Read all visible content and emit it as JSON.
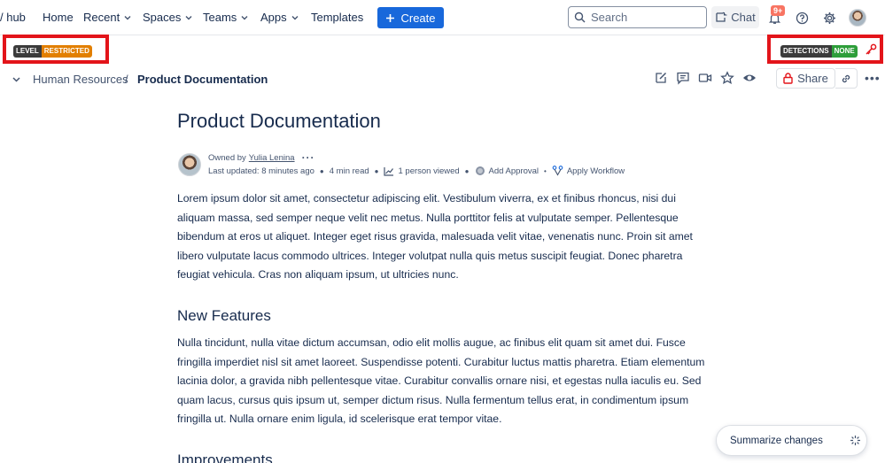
{
  "nav": {
    "brand": "/ hub",
    "home": "Home",
    "recent": "Recent",
    "spaces": "Spaces",
    "teams": "Teams",
    "apps": "Apps",
    "templates": "Templates",
    "create": "Create",
    "search_placeholder": "Search",
    "chat": "Chat",
    "notification_count": "9+"
  },
  "security": {
    "level_label": "LEVEL",
    "level_value": "RESTRICTED",
    "detections_label": "DETECTIONS",
    "detections_value": "NONE"
  },
  "breadcrumb": {
    "parent": "Human Resources",
    "separator": "/",
    "current": "Product Documentation"
  },
  "toolbar": {
    "share": "Share"
  },
  "page": {
    "title": "Product Documentation",
    "owned_by_prefix": "Owned by",
    "owner": "Yulia Lenina",
    "last_updated": "Last updated: 8 minutes ago",
    "read_time": "4 min read",
    "viewed": "1 person viewed",
    "add_approval": "Add Approval",
    "apply_workflow": "Apply Workflow",
    "intro": "Lorem ipsum dolor sit amet, consectetur adipiscing elit. Vestibulum viverra, ex et finibus rhoncus, nisi dui aliquam massa, sed semper neque velit nec metus. Nulla porttitor felis at vulputate semper. Pellentesque bibendum at eros ut aliquet. Integer eget risus gravida, malesuada velit vitae, venenatis nunc. Proin sit amet libero vulputate lacus commodo ultrices. Integer volutpat nulla quis metus suscipit feugiat. Donec pharetra feugiat vehicula. Cras non aliquam ipsum, ut ultricies nunc.",
    "section1_heading": "New Features",
    "section1_body": "Nulla tincidunt, nulla vitae dictum accumsan, odio elit mollis augue, ac finibus elit quam sit amet dui. Fusce fringilla imperdiet nisl sit amet laoreet. Suspendisse potenti. Curabitur luctus mattis pharetra. Etiam elementum lacinia dolor, a gravida nibh pellentesque vitae. Curabitur convallis ornare nisi, et egestas nulla iaculis eu. Sed quam lacus, cursus quis ipsum ut, semper dictum risus. Nulla fermentum tellus erat, in condimentum ipsum fringilla ut. Nulla ornare enim ligula, id scelerisque erat tempor vitae.",
    "section2_heading": "Improvements"
  },
  "summarize": {
    "label": "Summarize changes"
  },
  "colors": {
    "primary": "#1868db",
    "restricted": "#e27f00",
    "none_status": "#2e9e3a",
    "highlight_border": "#e3141a"
  }
}
